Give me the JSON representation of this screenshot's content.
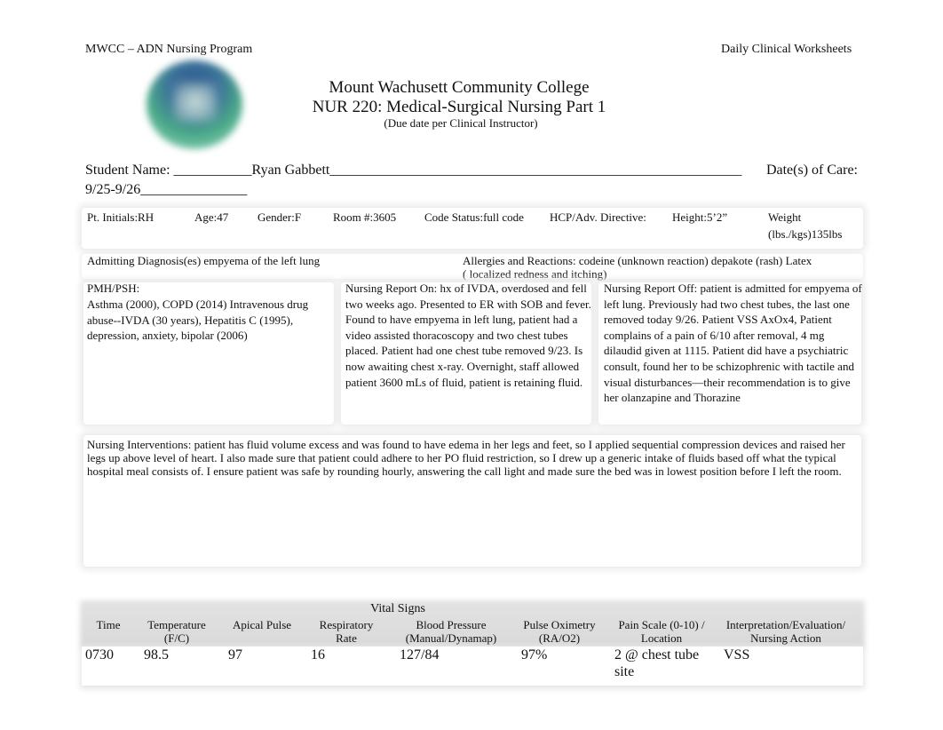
{
  "header": {
    "program": "MWCC – ADN Nursing Program",
    "worksheet": "Daily Clinical Worksheets",
    "college": "Mount Wachusett Community College",
    "course": "NUR 220: Medical-Surgical Nursing Part 1",
    "due_note": "(Due date per Clinical Instructor)"
  },
  "student": {
    "name_prefix": "Student Name: ___________",
    "name": "Ryan Gabbett",
    "name_suffix": "__________________________________________________________",
    "dates_label": "Date(s) of Care:",
    "dates_value": "9/25-9/26",
    "dates_suffix": "_______________"
  },
  "patient": {
    "initials": "Pt. Initials:RH",
    "age": "Age:47",
    "gender": "Gender:F",
    "room": "Room #:3605",
    "code_status": "Code Status:full code",
    "hcp": "HCP/Adv. Directive:",
    "height": "Height:5’2”",
    "weight_label": "Weight",
    "weight_value": "(lbs./kgs)135lbs"
  },
  "diagnosis": "Admitting Diagnosis(es) empyema of the left lung",
  "allergies": {
    "line1": "Allergies and Reactions: codeine (unknown reaction) depakote (rash) Latex",
    "line2": "( localized redness and itching)"
  },
  "pmh": {
    "label": "PMH/PSH:",
    "text": "Asthma (2000), COPD (2014) Intravenous drug abuse--IVDA (30 years), Hepatitis C (1995), depression, anxiety, bipolar (2006)"
  },
  "report_on": "Nursing Report On:  hx of IVDA, overdosed and fell two weeks ago. Presented to ER with SOB and fever. Found to have empyema in left lung, patient had a video assisted thoracoscopy and two chest tubes placed. Patient had one chest tube removed 9/23. Is now awaiting chest x-ray. Overnight, staff allowed patient 3600 mLs of fluid, patient is retaining fluid.",
  "report_off": "Nursing Report Off: patient is admitted for empyema of left lung. Previously had two chest tubes, the last one removed today 9/26. Patient VSS AxOx4, Patient complains of a pain of 6/10 after removal, 4 mg dilaudid given at 1115. Patient did have a psychiatric consult, found her to be schizophrenic with tactile and visual disturbances—their recommendation is to give her olanzapine and Thorazine",
  "interventions": "Nursing Interventions: patient has fluid volume excess and was found to have edema in her legs and feet, so I applied sequential compression devices and raised her legs up above level of heart. I also made sure that patient could adhere to her PO fluid restriction, so I drew up a generic intake of fluids based off what the typical hospital meal consists of.  I ensure patient was safe by rounding hourly, answering the call light and made sure the bed was in lowest position before I left the room.",
  "vitals": {
    "title": "Vital Signs",
    "headers": [
      "Time",
      "Temperature (F/C)",
      "Apical Pulse",
      "Respiratory Rate",
      "Blood Pressure (Manual/Dynamap)",
      "Pulse Oximetry (RA/O2)",
      "Pain Scale (0-10) / Location",
      "Interpretation/Evaluation/ Nursing Action"
    ],
    "rows": [
      {
        "time": "0730",
        "temperature": "98.5",
        "apical_pulse": "97",
        "respiratory_rate": "16",
        "blood_pressure": "127/84",
        "pulse_oximetry": "97%",
        "pain": "2 @ chest tube site",
        "interpretation": "VSS"
      }
    ]
  }
}
